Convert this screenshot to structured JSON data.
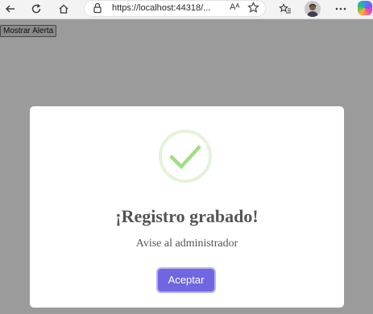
{
  "browser": {
    "url": "https://localhost:44318/...",
    "reader_label": "Aᴬ"
  },
  "page": {
    "button_label": "Mostrar Alerta"
  },
  "modal": {
    "icon": "success-check-icon",
    "title": "¡Registro grabado!",
    "text": "Avise al administrador",
    "confirm_label": "Aceptar",
    "colors": {
      "confirm": "#7066e0",
      "icon": "#a5dc86"
    }
  }
}
